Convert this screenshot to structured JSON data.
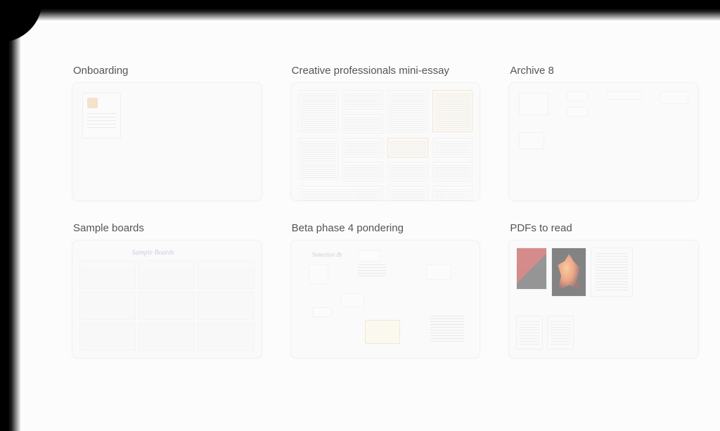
{
  "boards": [
    {
      "id": "onboarding",
      "title": "Onboarding"
    },
    {
      "id": "essay",
      "title": "Creative professionals mini-essay"
    },
    {
      "id": "archive",
      "title": "Archive 8"
    },
    {
      "id": "samples",
      "title": "Sample boards"
    },
    {
      "id": "beta",
      "title": "Beta phase 4 pondering"
    },
    {
      "id": "pdfs",
      "title": "PDFs to read"
    }
  ],
  "handwriting": {
    "samples": "Sample Boards",
    "beta": "Selection Br"
  }
}
